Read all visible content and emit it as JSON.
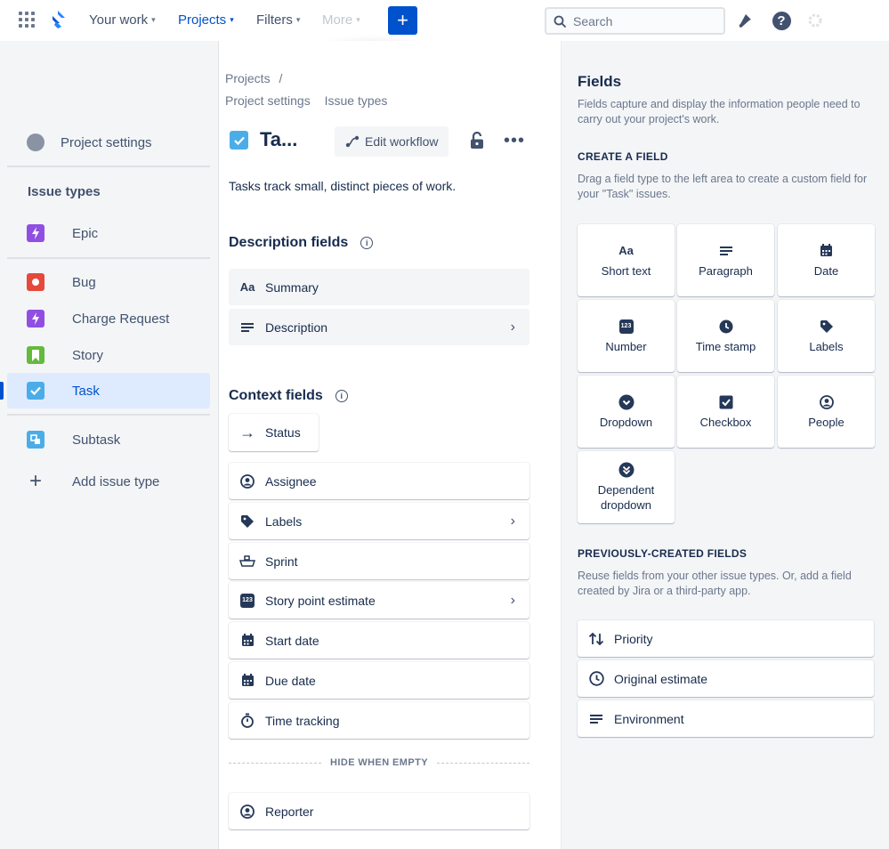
{
  "nav": {
    "your_work": "Your work",
    "projects": "Projects",
    "filters": "Filters",
    "more": "More",
    "create": "+",
    "search_placeholder": "Search"
  },
  "breadcrumb": {
    "projects": "Projects",
    "separator": "/",
    "project_settings": "Project settings",
    "issue_types": "Issue types"
  },
  "sidebar": {
    "project_settings": "Project settings",
    "issue_types_heading": "Issue types",
    "items": [
      {
        "label": "Epic",
        "color": "#904EE2",
        "icon": "lightning-icon"
      },
      {
        "label": "Bug",
        "color": "#E5493A",
        "icon": "bug-icon"
      },
      {
        "label": "Charge Request",
        "color": "#904EE2",
        "icon": "lightning-icon"
      },
      {
        "label": "Story",
        "color": "#63BA3C",
        "icon": "bookmark-icon"
      },
      {
        "label": "Task",
        "color": "#4BADE8",
        "icon": "check-icon"
      },
      {
        "label": "Subtask",
        "color": "#4BADE8",
        "icon": "subtask-icon"
      }
    ],
    "add_issue_type": "Add issue type"
  },
  "main": {
    "title": "Ta...",
    "edit_workflow": "Edit workflow",
    "description": "Tasks track small, distinct pieces of work.",
    "description_fields_title": "Description fields",
    "description_fields": [
      {
        "label": "Summary",
        "icon": "text-aa-icon"
      },
      {
        "label": "Description",
        "icon": "paragraph-icon"
      }
    ],
    "context_fields_title": "Context fields",
    "status": "Status",
    "context_fields": [
      {
        "label": "Assignee",
        "icon": "person-icon"
      },
      {
        "label": "Labels",
        "icon": "tag-icon"
      },
      {
        "label": "Sprint",
        "icon": "sprint-icon"
      },
      {
        "label": "Story point estimate",
        "icon": "number-icon"
      },
      {
        "label": "Start date",
        "icon": "calendar-icon"
      },
      {
        "label": "Due date",
        "icon": "calendar-icon"
      },
      {
        "label": "Time tracking",
        "icon": "stopwatch-icon"
      }
    ],
    "hide_when_empty": "HIDE WHEN EMPTY",
    "reporter": "Reporter"
  },
  "panel": {
    "title": "Fields",
    "intro": "Fields capture and display the information people need to carry out your project's work.",
    "create_heading": "CREATE A FIELD",
    "create_text": "Drag a field type to the left area to create a custom field for your \"Task\" issues.",
    "field_types": [
      {
        "label": "Short text",
        "icon": "text-aa-icon"
      },
      {
        "label": "Paragraph",
        "icon": "paragraph-icon"
      },
      {
        "label": "Date",
        "icon": "calendar-icon"
      },
      {
        "label": "Number",
        "icon": "number-icon"
      },
      {
        "label": "Time stamp",
        "icon": "clock-icon"
      },
      {
        "label": "Labels",
        "icon": "tag-icon"
      },
      {
        "label": "Dropdown",
        "icon": "dropdown-icon"
      },
      {
        "label": "Checkbox",
        "icon": "checkbox-icon"
      },
      {
        "label": "People",
        "icon": "person-icon"
      },
      {
        "label": "Dependent dropdown",
        "icon": "dependent-dropdown-icon"
      }
    ],
    "previous_heading": "PREVIOUSLY-CREATED FIELDS",
    "previous_text": "Reuse fields from your other issue types. Or, add a field created by Jira or a third-party app.",
    "previous_fields": [
      {
        "label": "Priority",
        "icon": "priority-icon"
      },
      {
        "label": "Original estimate",
        "icon": "clock-icon"
      },
      {
        "label": "Environment",
        "icon": "paragraph-icon"
      }
    ]
  },
  "colors": {
    "brand": "#0052CC",
    "sidebar_bg": "#F4F5F7",
    "selected_bg": "#DEEBFF"
  }
}
